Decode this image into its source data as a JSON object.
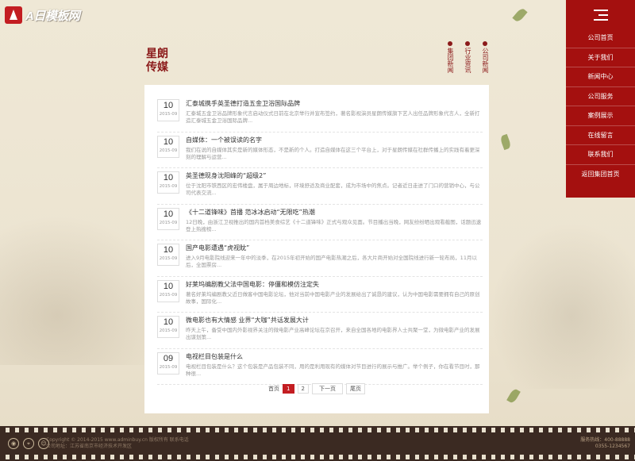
{
  "logo": {
    "text": "A日模板网"
  },
  "section_title": {
    "line1": "星朗",
    "line2": "传媒"
  },
  "subnav": [
    {
      "label": "集团新闻"
    },
    {
      "label": "行业资讯"
    },
    {
      "label": "公司新闻"
    }
  ],
  "side_menu": [
    {
      "label": "公司首页"
    },
    {
      "label": "关于我们"
    },
    {
      "label": "新闻中心"
    },
    {
      "label": "公司服务"
    },
    {
      "label": "案例展示"
    },
    {
      "label": "在线留言"
    },
    {
      "label": "联系我们"
    },
    {
      "label": "返回集团首页"
    }
  ],
  "news": [
    {
      "day": "10",
      "ym": "2015-09",
      "title": "汇泰城携手英圣德打造五金卫浴国际品牌",
      "summary": "汇泰城五金卫浴品牌形象代言启动仪式日前在北京举行并宣布签约，著名影视演员星朗传媒旗下艺人出任品牌形象代言人，全新打造汇泰城五金卫浴国际品牌..."
    },
    {
      "day": "10",
      "ym": "2015-09",
      "title": "自媒体：一个被误读的名字",
      "summary": "我们在说的自媒体其实是新的媒体形态，不是新的个人。打造自媒体在这三个平台上，对于星朗传媒在社群传播上的实践有着更深刻的理解与运营..."
    },
    {
      "day": "10",
      "ym": "2015-09",
      "title": "英圣德现身沈阳峰的“超级2”",
      "summary": "位于沈阳市铁西区的宏伟楼盘，属于周边地标，环境舒适及商业配套，成为市场中的焦点。记者近日走进了门口的营销中心，与公司代表交流..."
    },
    {
      "day": "10",
      "ym": "2015-09",
      "title": "《十二道锋味》首播 范冰冰启动“无限吃”热潮",
      "summary": "12日晚，由浙江卫视推出的国内首档美食综艺《十二道锋味》正式与观众见面。节目播出当晚，网友纷纷晒出观看截图，话题迅速登上热搜榜..."
    },
    {
      "day": "10",
      "ym": "2015-09",
      "title": "国产电影遭遇“虎视眈”",
      "summary": "进入9月电影院线迎来一年中的淡季，在2015年初开始的国产电影热潮之后，各大片商开始对全国院线进行新一轮布局，11月以后，全国票房..."
    },
    {
      "day": "10",
      "ym": "2015-09",
      "title": "好莱坞编剧教父法中国电影：停僵和模仿注定失",
      "summary": "著名好莱坞编剧教父近日做客中国电影论坛，他对当前中国电影产业的发展给出了诚恳的建议，认为中国电影需要拥有自己的原创故事，国际化..."
    },
    {
      "day": "10",
      "ym": "2015-09",
      "title": "微电影也有大情感 业界“大咖”共话发展大计",
      "summary": "昨天上午，备受中国内外影视界关注的微电影产业高峰论坛在京召开，来自全国各地的电影界人士共聚一堂，为微电影产业的发展出谋划策..."
    },
    {
      "day": "09",
      "ym": "2015-09",
      "title": "电视栏目包装是什么",
      "summary": "电视栏目包装是什么？这个包装是产品包装不同，用的是利用现有的媒体对节目进行的展示与推广。举个例子，你在看节目时，那种很..."
    }
  ],
  "pager": {
    "first_label": "首页",
    "pages": [
      "1",
      "2"
    ],
    "next_label": "下一页",
    "last_label": "尾页"
  },
  "footer": {
    "copyright": "Copyright © 2014-2015 www.adminbuy.cn 版权所有 联系电话",
    "address": "公司地址：江苏省南京市经济技术开发区",
    "hotline_label": "服务热线：400-88888",
    "hotline_number": "0355-1234567"
  },
  "colors": {
    "brand_red": "#a4100f",
    "accent": "#c31d22",
    "footer_bg": "#3b2a22"
  },
  "icons": {
    "menu": "hamburger-menu-icon"
  }
}
